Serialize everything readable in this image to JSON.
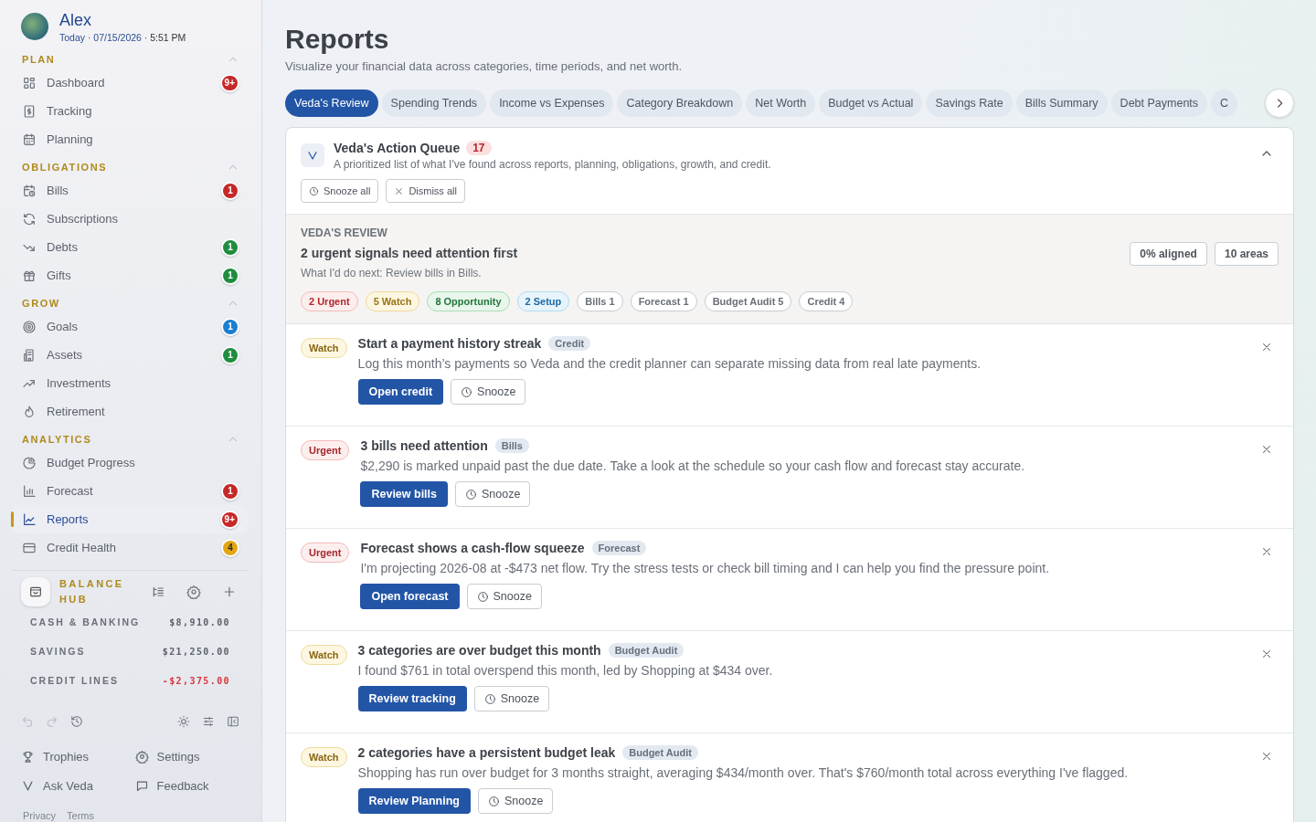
{
  "user": {
    "name": "Alex",
    "date_line": "Today · 07/15/2026 · **5:51 PM**"
  },
  "sidebar": {
    "sections": [
      {
        "title": "PLAN",
        "expanded": true,
        "items": [
          {
            "label": "Dashboard",
            "selected": false,
            "badge": "9+",
            "color": "#c62828"
          },
          {
            "label": "Tracking",
            "selected": false
          },
          {
            "label": "Planning",
            "selected": false
          }
        ]
      },
      {
        "title": "OBLIGATIONS",
        "expanded": true,
        "items": [
          {
            "label": "Bills",
            "selected": false,
            "badge": "1",
            "color": "#c62828"
          },
          {
            "label": "Subscriptions",
            "selected": false
          },
          {
            "label": "Debts",
            "selected": false,
            "badge": "1",
            "color": "#1e8e3e"
          },
          {
            "label": "Gifts",
            "selected": false,
            "badge": "1",
            "color": "#1e8e3e"
          }
        ]
      },
      {
        "title": "GROW",
        "expanded": true,
        "items": [
          {
            "label": "Goals",
            "selected": false,
            "badge": "1",
            "color": "#1a7fd0"
          },
          {
            "label": "Assets",
            "selected": false,
            "badge": "1",
            "color": "#1e8e3e"
          },
          {
            "label": "Investments",
            "selected": false
          },
          {
            "label": "Retirement",
            "selected": false
          }
        ]
      },
      {
        "title": "ANALYTICS",
        "expanded": true,
        "items": [
          {
            "label": "Budget Progress",
            "selected": false
          },
          {
            "label": "Forecast",
            "selected": false,
            "badge": "1",
            "color": "#c62828"
          },
          {
            "label": "Reports",
            "selected": true,
            "badge": "9+",
            "color": "#c62828"
          },
          {
            "label": "Credit Health",
            "selected": false,
            "badge": "4",
            "color": "#e3a514"
          }
        ]
      }
    ],
    "balance_hub": {
      "title": "BALANCE HUB",
      "rows": [
        {
          "label": "CASH & BANKING",
          "amount": "$8,910.00",
          "negative": false
        },
        {
          "label": "SAVINGS",
          "amount": "$21,250.00",
          "negative": false
        },
        {
          "label": "CREDIT LINES",
          "amount": "-$2,375.00",
          "negative": true
        }
      ]
    },
    "links": [
      "Trophies",
      "Settings",
      "Ask Veda",
      "Feedback"
    ],
    "footer": [
      "Privacy",
      "Terms"
    ]
  },
  "page": {
    "title": "Reports",
    "subtitle": "Visualize your financial data across categories, time periods, and net worth."
  },
  "tabs": [
    {
      "label": "Veda's Review",
      "selected": true
    },
    {
      "label": "Spending Trends",
      "selected": false
    },
    {
      "label": "Income vs Expenses",
      "selected": false
    },
    {
      "label": "Category Breakdown",
      "selected": false
    },
    {
      "label": "Net Worth",
      "selected": false
    },
    {
      "label": "Budget vs Actual",
      "selected": false
    },
    {
      "label": "Savings Rate",
      "selected": false
    },
    {
      "label": "Bills Summary",
      "selected": false
    },
    {
      "label": "Debt Payments",
      "selected": false
    },
    {
      "label": "C",
      "selected": false
    }
  ],
  "queue": {
    "title": "Veda's Action Queue",
    "count": "17",
    "description": "A prioritized list of what I've found across reports, planning, obligations, growth, and credit.",
    "expanded": true,
    "buttons": [
      "Snooze all",
      "Dismiss all"
    ]
  },
  "review": {
    "eyebrow": "VEDA'S REVIEW",
    "headline": "2 urgent signals need attention first",
    "next_step": "What I'd do next: Review bills in Bills.",
    "stats": [
      "0% aligned",
      "10 areas"
    ],
    "chips": [
      {
        "label": "2 Urgent",
        "kind": "urgent"
      },
      {
        "label": "5 Watch",
        "kind": "watch"
      },
      {
        "label": "8 Opportunity",
        "kind": "opportunity"
      },
      {
        "label": "2 Setup",
        "kind": "setup"
      },
      {
        "label": "Bills 1",
        "kind": "plain"
      },
      {
        "label": "Forecast 1",
        "kind": "plain"
      },
      {
        "label": "Budget Audit 5",
        "kind": "plain"
      },
      {
        "label": "Credit 4",
        "kind": "plain"
      }
    ]
  },
  "items": [
    {
      "priority": "Watch",
      "kind": "watch",
      "title": "Start a payment history streak",
      "tag": "Credit",
      "description": "Log this month’s payments so Veda and the credit planner can separate missing data from real late payments.",
      "action": "Open credit",
      "snooze": "Snooze"
    },
    {
      "priority": "Urgent",
      "kind": "urgent",
      "title": "3 bills need attention",
      "tag": "Bills",
      "description": "$2,290 is marked unpaid past the due date. Take a look at the schedule so your cash flow and forecast stay accurate.",
      "action": "Review bills",
      "snooze": "Snooze"
    },
    {
      "priority": "Urgent",
      "kind": "urgent",
      "title": "Forecast shows a cash-flow squeeze",
      "tag": "Forecast",
      "description": "I'm projecting 2026-08 at -$473 net flow. Try the stress tests or check bill timing and I can help you find the pressure point.",
      "action": "Open forecast",
      "snooze": "Snooze"
    },
    {
      "priority": "Watch",
      "kind": "watch",
      "title": "3 categories are over budget this month",
      "tag": "Budget Audit",
      "description": "I found $761 in total overspend this month, led by Shopping at $434 over.",
      "action": "Review tracking",
      "snooze": "Snooze"
    },
    {
      "priority": "Watch",
      "kind": "watch",
      "title": "2 categories have a persistent budget leak",
      "tag": "Budget Audit",
      "description": "Shopping has run over budget for 3 months straight, averaging $434/month over. That's $760/month total across everything I've flagged.",
      "action": "Review Planning",
      "snooze": "Snooze"
    }
  ]
}
